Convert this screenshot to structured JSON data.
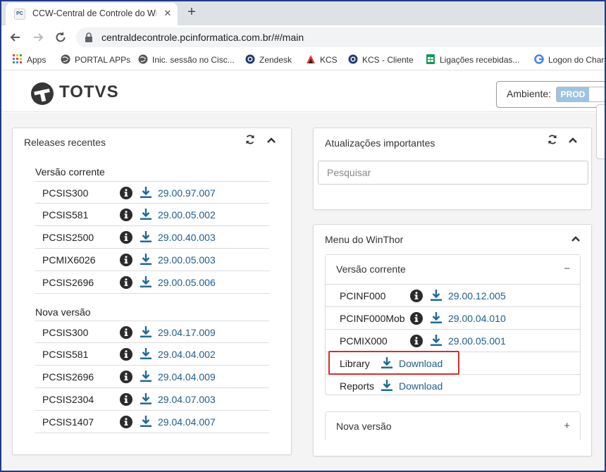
{
  "browser": {
    "tab_title": "CCW-Central de Controle do WinThor",
    "tab_favicon": "PC",
    "tab_close": "✕",
    "new_tab": "+",
    "url": "centraldecontrole.pcinformatica.com.br/#/main",
    "bookmarks": [
      {
        "label": "Apps",
        "icon": "apps-grid-icon"
      },
      {
        "label": "PORTAL APPs",
        "icon": "globe-icon"
      },
      {
        "label": "Inic. sessão no Cisc...",
        "icon": "globe-icon"
      },
      {
        "label": "Zendesk",
        "icon": "zendesk-icon"
      },
      {
        "label": "KCS",
        "icon": "kcs-icon"
      },
      {
        "label": "KCS - Cliente",
        "icon": "zendesk-icon"
      },
      {
        "label": "Ligações recebidas...",
        "icon": "sheets-icon"
      },
      {
        "label": "Logon do Char",
        "icon": "google-icon"
      }
    ]
  },
  "header": {
    "logo_text": "TOTVS",
    "ambiente_label": "Ambiente:",
    "ambiente_value": "PROD"
  },
  "releases": {
    "title": "Releases recentes",
    "current": {
      "label": "Versão corrente",
      "items": [
        {
          "name": "PCSIS300",
          "version": "29.00.97.007"
        },
        {
          "name": "PCSIS581",
          "version": "29.00.05.002"
        },
        {
          "name": "PCSIS2500",
          "version": "29.00.40.003"
        },
        {
          "name": "PCMIX6026",
          "version": "29.00.05.003"
        },
        {
          "name": "PCSIS2696",
          "version": "29.00.05.006"
        }
      ]
    },
    "new": {
      "label": "Nova versão",
      "items": [
        {
          "name": "PCSIS300",
          "version": "29.04.17.009"
        },
        {
          "name": "PCSIS581",
          "version": "29.04.04.002"
        },
        {
          "name": "PCSIS2696",
          "version": "29.04.04.009"
        },
        {
          "name": "PCSIS2304",
          "version": "29.04.07.003"
        },
        {
          "name": "PCSIS1407",
          "version": "29.04.04.007"
        }
      ]
    }
  },
  "updates": {
    "title": "Atualizações importantes",
    "search_placeholder": "Pesquisar"
  },
  "menu": {
    "title": "Menu do WinThor",
    "current": {
      "label": "Versão corrente",
      "toggle": "−",
      "items": [
        {
          "name": "PCINF000",
          "version": "29.00.12.005"
        },
        {
          "name": "PCINF000Mob",
          "version": "29.00.04.010"
        },
        {
          "name": "PCMIX000",
          "version": "29.00.05.001"
        }
      ],
      "library": {
        "name": "Library",
        "link": "Download"
      },
      "reports": {
        "name": "Reports",
        "link": "Download"
      }
    },
    "new": {
      "label": "Nova versão",
      "toggle": "+"
    }
  },
  "colors": {
    "link": "#1e5d8e",
    "icon": "#2b2b2b",
    "download": "#1e6a9a",
    "highlight": "#d32f2f",
    "toggle": "#9fc3e0"
  }
}
